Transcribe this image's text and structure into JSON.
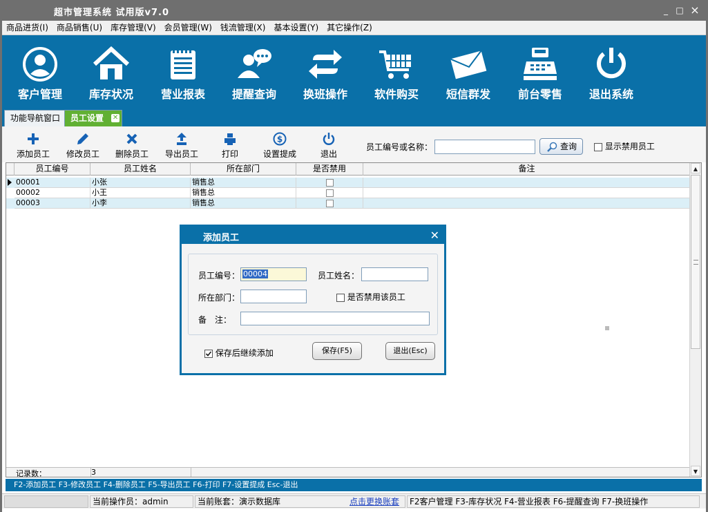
{
  "window": {
    "title": "超市管理系统 试用版v7.0",
    "minimize": "_",
    "maximize": "□",
    "close": "×"
  },
  "menu": [
    "商品进货(I)",
    "商品销售(U)",
    "库存管理(V)",
    "会员管理(W)",
    "钱流管理(X)",
    "基本设置(Y)",
    "其它操作(Z)"
  ],
  "nav": [
    {
      "label": "客户管理",
      "icon": "user-icon"
    },
    {
      "label": "库存状况",
      "icon": "house-icon"
    },
    {
      "label": "营业报表",
      "icon": "report-icon"
    },
    {
      "label": "提醒查询",
      "icon": "chat-user-icon"
    },
    {
      "label": "换班操作",
      "icon": "swap-icon"
    },
    {
      "label": "软件购买",
      "icon": "cart-icon"
    },
    {
      "label": "短信群发",
      "icon": "envelope-icon"
    },
    {
      "label": "前台零售",
      "icon": "cash-register-icon"
    },
    {
      "label": "退出系统",
      "icon": "power-icon"
    }
  ],
  "tabs": [
    {
      "label": "功能导航窗口"
    },
    {
      "label": "员工设置"
    }
  ],
  "toolbar": {
    "buttons": [
      {
        "label": "添加员工",
        "icon": "plus-icon"
      },
      {
        "label": "修改员工",
        "icon": "pencil-icon"
      },
      {
        "label": "删除员工",
        "icon": "x-icon"
      },
      {
        "label": "导出员工",
        "icon": "upload-icon"
      },
      {
        "label": "打印",
        "icon": "print-icon"
      },
      {
        "label": "设置提成",
        "icon": "dollar-icon"
      },
      {
        "label": "退出",
        "icon": "power-icon"
      }
    ],
    "search_label": "员工编号或名称：",
    "search_value": "",
    "query_label": "查询",
    "show_disabled_label": "显示禁用员工",
    "show_disabled_checked": false
  },
  "grid": {
    "columns": [
      "员工编号",
      "员工姓名",
      "所在部门",
      "是否禁用",
      "备注"
    ],
    "rows": [
      {
        "id": "00001",
        "name": "小张",
        "dept": "销售总",
        "disabled": false,
        "note": ""
      },
      {
        "id": "00002",
        "name": "小王",
        "dept": "销售总",
        "disabled": false,
        "note": ""
      },
      {
        "id": "00003",
        "name": "小李",
        "dept": "销售总",
        "disabled": false,
        "note": ""
      }
    ],
    "footer_label": "记录数：",
    "footer_count": "3"
  },
  "hotkeys": "F2-添加员工 F3-修改员工 F4-删除员工 F5-导出员工 F6-打印 F7-设置提成 Esc-退出",
  "status": {
    "operator": "当前操作员：admin",
    "account": "当前账套：演示数据库",
    "switch_link": "点击更换账套",
    "shortcuts": "F2客户管理 F3-库存状况 F4-营业报表 F6-提醒查询 F7-换班操作"
  },
  "dialog": {
    "title": "添加员工",
    "id_label": "员工编号：",
    "id_value": "00004",
    "name_label": "员工姓名：",
    "name_value": "",
    "dept_label": "所在部门：",
    "dept_value": "",
    "disable_label": "是否禁用该员工",
    "disable_checked": false,
    "note_label": "备　注：",
    "note_value": "",
    "continue_label": "保存后继续添加",
    "continue_checked": true,
    "save_label": "保存(F5)",
    "exit_label": "退出(Esc)"
  }
}
